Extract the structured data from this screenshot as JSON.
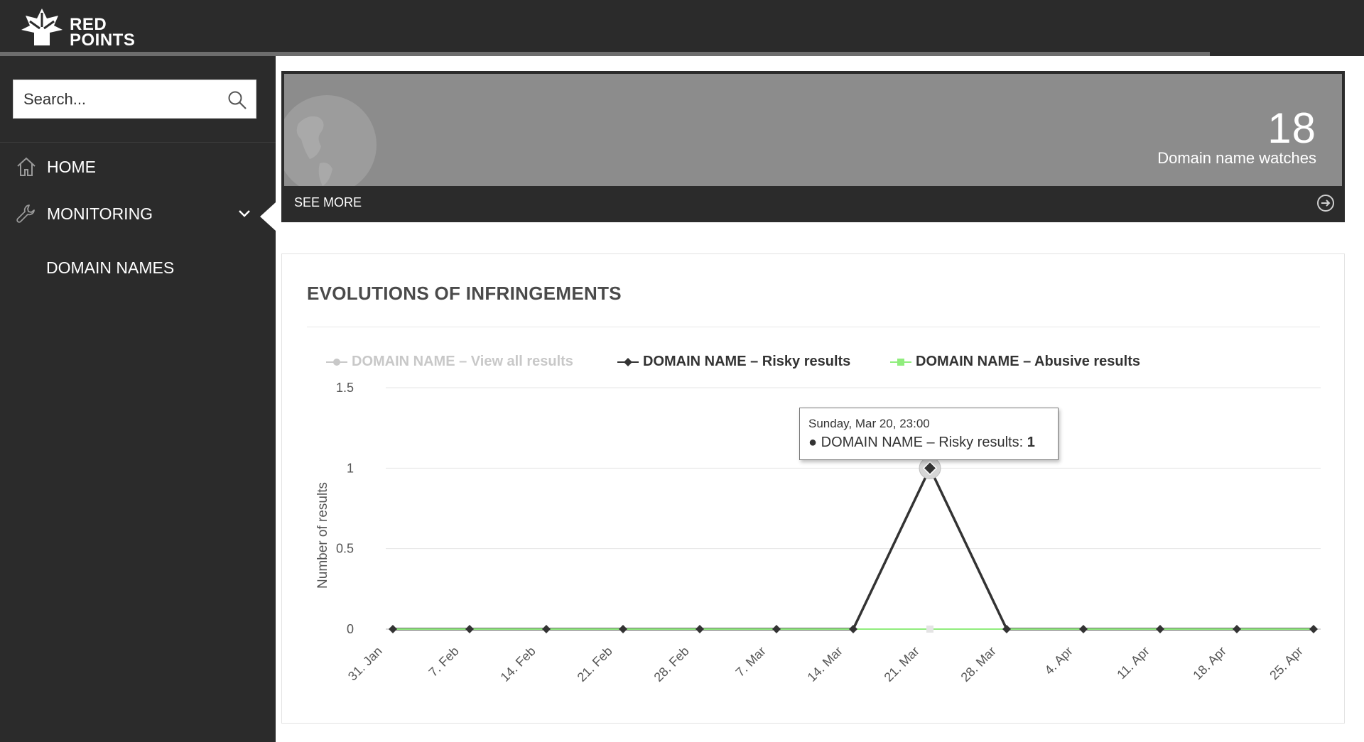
{
  "brand": {
    "line1": "RED",
    "line2": "POINTS",
    "icon": "red-points-logo-icon"
  },
  "search": {
    "placeholder": "Search..."
  },
  "sidebar": {
    "items": [
      {
        "label": "HOME",
        "icon": "home-icon"
      },
      {
        "label": "MONITORING",
        "icon": "wrench-icon",
        "expanded": true
      },
      {
        "label": "DOMAIN NAMES",
        "icon": ""
      }
    ]
  },
  "stat_card": {
    "value": "18",
    "label": "Domain name watches",
    "see_more": "SEE MORE"
  },
  "chart_section": {
    "title": "EVOLUTIONS OF INFRINGEMENTS"
  },
  "tooltip": {
    "date": "Sunday, Mar 20, 23:00",
    "series": "DOMAIN NAME – Risky results: ",
    "value": "1"
  },
  "colors": {
    "dark": "#2b2b2b",
    "card_gray": "#8c8c8c",
    "series_all": "#c8c8c8",
    "series_risky": "#333333",
    "series_abusive": "#90ed7d"
  },
  "chart_data": {
    "type": "line",
    "title": "",
    "xlabel": "",
    "ylabel": "Number of results",
    "ylim": [
      0,
      1.5
    ],
    "yticks": [
      "0",
      "0.5",
      "1",
      "1.5"
    ],
    "categories": [
      "31. Jan",
      "7. Feb",
      "14. Feb",
      "21. Feb",
      "28. Feb",
      "7. Mar",
      "14. Mar",
      "21. Mar",
      "28. Mar",
      "4. Apr",
      "11. Apr",
      "18. Apr",
      "25. Apr"
    ],
    "legend_position": "top-left",
    "grid": true,
    "series": [
      {
        "name": "DOMAIN NAME – View all results",
        "color": "#c8c8c8",
        "values": [
          0,
          0,
          0,
          0,
          0,
          0,
          0,
          0,
          0,
          0,
          0,
          0,
          0
        ],
        "hidden": true
      },
      {
        "name": "DOMAIN NAME – Risky results",
        "color": "#333333",
        "values": [
          0,
          0,
          0,
          0,
          0,
          0,
          0,
          1,
          0,
          0,
          0,
          0,
          0
        ]
      },
      {
        "name": "DOMAIN NAME – Abusive results",
        "color": "#90ed7d",
        "values": [
          0,
          0,
          0,
          0,
          0,
          0,
          0,
          0,
          0,
          0,
          0,
          0,
          0
        ]
      }
    ]
  }
}
